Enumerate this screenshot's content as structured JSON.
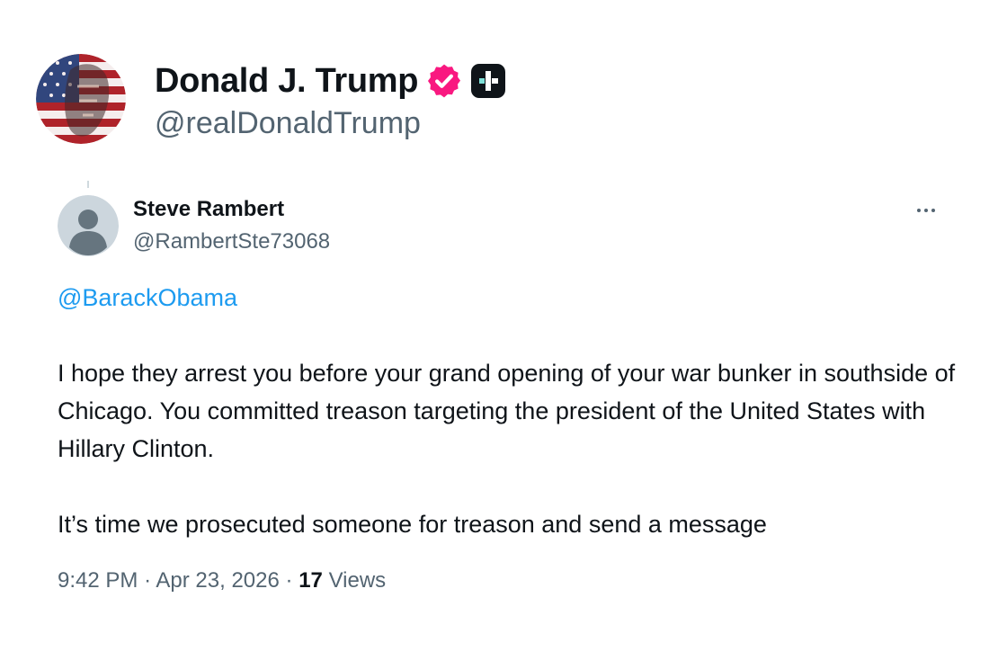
{
  "poster": {
    "name": "Donald J. Trump",
    "handle": "@realDonaldTrump",
    "avatar_icon": "flag-portrait-avatar",
    "verified_icon": "verified-badge-icon",
    "verified_color": "#f91880",
    "affiliate_icon": "affiliate-badge-icon"
  },
  "reply": {
    "name": "Steve Rambert",
    "handle": "@RambertSte73068",
    "avatar_icon": "default-profile-avatar",
    "more_icon": "more-options-icon",
    "mention": "@BarackObama",
    "mention_color": "#1d9bf0",
    "paragraphs": [
      "I hope they arrest you before your grand opening of your war bunker in southside of Chicago. You committed treason targeting the president of the United States with Hillary Clinton.",
      "It’s time we prosecuted someone for treason and send a message"
    ],
    "time": "9:42 PM",
    "separator": "·",
    "date": "Apr 23, 2026",
    "views_count": "17",
    "views_label": "Views"
  }
}
